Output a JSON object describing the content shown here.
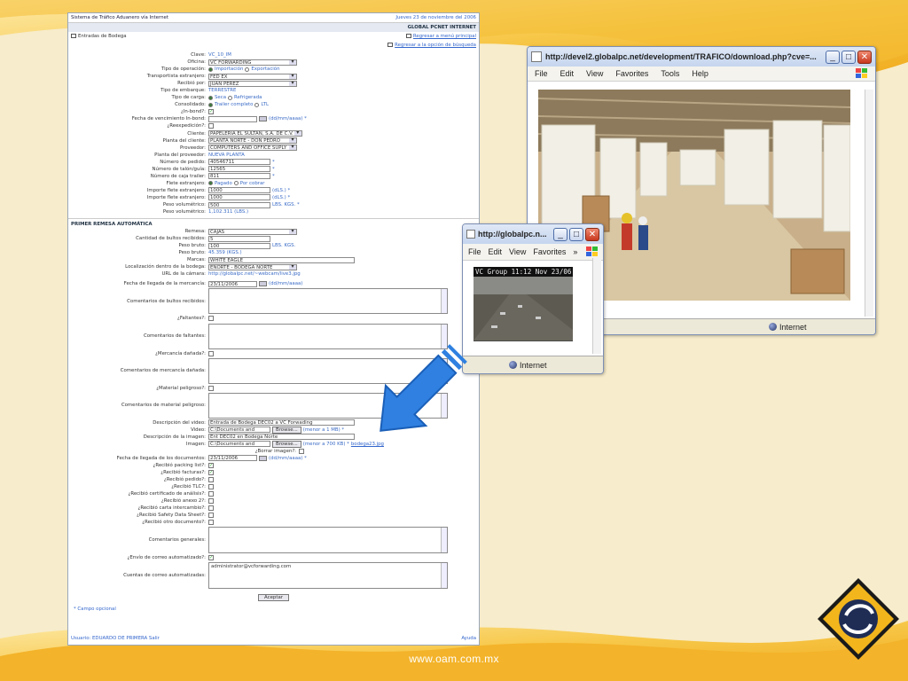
{
  "colors": {
    "accent_blue": "#2f80e0",
    "brand_yellow": "#f2b51c",
    "diamond_outline": "#1a1a1a"
  },
  "form": {
    "system_title": "Sistema de Tráfico Aduanero vía Internet",
    "date": "Jueves 23 de noviembre del 2006",
    "company": "GLOBAL PCNET INTERNET",
    "section_title": "Entradas de Bodega",
    "link_main_menu": "Regresar a menú principal",
    "link_search": "Regresar a la opción de búsqueda",
    "fields": [
      {
        "label": "Clave:",
        "type": "text",
        "value": "VC_10_IM",
        "blue": true
      },
      {
        "label": "Oficina:",
        "type": "select",
        "value": "VC FORWARDING"
      },
      {
        "label": "Tipo de operación:",
        "type": "radio",
        "options": [
          "Importación",
          "Exportación"
        ],
        "selected": 0
      },
      {
        "label": "Transportista extranjero:",
        "type": "select",
        "value": "FED EX"
      },
      {
        "label": "Recibió por:",
        "type": "select",
        "value": "JUAN PEREZ"
      },
      {
        "label": "Tipo de embarque:",
        "type": "text",
        "value": "TERRESTRE",
        "blue": true
      },
      {
        "label": "Tipo de carga:",
        "type": "radio",
        "options": [
          "Seca",
          "Refrigerada"
        ],
        "selected": 0
      },
      {
        "label": "Consolidado:",
        "type": "radio",
        "options": [
          "Trailer completo",
          "LTL"
        ],
        "selected": 0
      },
      {
        "label": "¿In-bond?:",
        "type": "check",
        "checked": true
      },
      {
        "label": "Fecha de vencimiento In-bond:",
        "type": "date",
        "value": "",
        "note": "(dd/mm/aaaa) *"
      },
      {
        "label": "¿Reexpedición?:",
        "type": "check",
        "checked": false
      },
      {
        "label": "Cliente:",
        "type": "select",
        "value": "PAPELERIA EL SULTAN, S.A. DE C.V."
      },
      {
        "label": "Planta del cliente:",
        "type": "select",
        "value": "PLANTA NORTE - DON PEDRO"
      },
      {
        "label": "Proveedor:",
        "type": "select",
        "value": "COMPUTERS AND OFFICE SUPLY"
      },
      {
        "label": "Planta del proveedor:",
        "type": "text",
        "value": "NUEVA PLANTA",
        "blue": true
      },
      {
        "label": "Número de pedido:",
        "type": "input",
        "value": "40546711",
        "note": "*"
      },
      {
        "label": "Número de talón/guía:",
        "type": "input",
        "value": "12565",
        "note": "*"
      },
      {
        "label": "Número de caja trailer:",
        "type": "input",
        "value": "811",
        "note": "*"
      },
      {
        "label": "Flete extranjero:",
        "type": "radio",
        "options": [
          "Pagado",
          "Por cobrar"
        ],
        "selected": 0
      },
      {
        "label": "Importe flete extranjero:",
        "type": "input",
        "value": "1000",
        "note": "(dLS.) *"
      },
      {
        "label": "Importe flete extranjero:",
        "type": "input",
        "value": "1000",
        "note": "(dLS.) *"
      },
      {
        "label": "Peso volumétrico:",
        "type": "input",
        "value": "500",
        "note": "LBS.  KGS. *"
      },
      {
        "label": "Peso volumétrico:",
        "type": "text",
        "value": "1,102.311 (LBS.)",
        "blue": true
      }
    ],
    "first_pass_title": "PRIMER REMESA AUTOMÁTICA",
    "fields2": [
      {
        "label": "Remesa:",
        "type": "select",
        "value": "CAJAS"
      },
      {
        "label": "Cantidad de bultos recibidos:",
        "type": "input",
        "value": "5"
      },
      {
        "label": "Peso bruto:",
        "type": "input",
        "value": "100",
        "note": "LBS.  KGS."
      },
      {
        "label": "Peso bruto:",
        "type": "text",
        "value": "45.359 (KGS.)",
        "blue": true
      },
      {
        "label": "Marcas:",
        "type": "input",
        "value": "WHITE EAGLE"
      },
      {
        "label": "Localización dentro de la bodega:",
        "type": "select",
        "value": "ENORTE - BODEGA NORTE"
      },
      {
        "label": "URL de la cámara:",
        "type": "text",
        "value": "http://globalpc.net/~webcam/live3.jpg",
        "blue": true
      }
    ],
    "arrival_label": "Fecha de llegada de la mercancía:",
    "arrival_value": "23/11/2006",
    "arrival_note": "(dd/mm/aaaa)",
    "textareas": [
      {
        "label": "Comentarios de bultos recibidos:"
      },
      {
        "label": "¿Faltantes?:",
        "check": true
      },
      {
        "label": "Comentarios de faltantes:"
      },
      {
        "label": "¿Mercancía dañada?:",
        "check": true
      },
      {
        "label": "Comentarios de mercancía dañada:"
      },
      {
        "label": "¿Material peligroso?:",
        "check": true
      },
      {
        "label": "Comentarios de material peligroso:"
      }
    ],
    "video_desc_label": "Descripción del video:",
    "video_desc_value": "Entrada de Bodega DEC02 a VC Forwading",
    "video_label": "Video:",
    "video_path": "C:\\Documents and",
    "browse": "Browse...",
    "video_note": "(menor a 1 MB) *",
    "image_desc_label": "Descripción de la imagen:",
    "image_desc_value": "Ent DEC02 en Bodega Norte",
    "image_label": "Imagen:",
    "image_path": "C:\\Documents and",
    "image_note": "(menor a 700 KB) *",
    "image_link": "bodega23.jpg",
    "delete_image": "¿Borrar imagen?:",
    "docs_label": "Fecha de llegada de los documentos:",
    "docs_value": "23/11/2006",
    "docs_note": "(dd/mm/aaaa) *",
    "checks": [
      {
        "label": "¿Recibió packing list?:",
        "checked": true
      },
      {
        "label": "¿Recibió facturas?:",
        "checked": true
      },
      {
        "label": "¿Recibió pedido?:",
        "checked": false
      },
      {
        "label": "¿Recibió TLC?:",
        "checked": false
      },
      {
        "label": "¿Recibió certificado de análisis?:",
        "checked": false
      },
      {
        "label": "¿Recibió anexo 2?:",
        "checked": false
      },
      {
        "label": "¿Recibió carta intercambio?:",
        "checked": false
      },
      {
        "label": "¿Recibió Safety Data Sheet?:",
        "checked": false
      },
      {
        "label": "¿Recibió otro documento?:",
        "checked": false
      }
    ],
    "general_comments": "Comentarios generales:",
    "auto_email_label": "¿Envío de correo automatizado?:",
    "auto_email_accounts_label": "Cuentas de correo automatizadas:",
    "auto_email_value": "administrator@vcforwarding.com",
    "accept": "Aceptar",
    "optional_note": "* Campo opcional",
    "footer_user": "Usuario: EDUARDO DE PRIMERA   Salir",
    "footer_right": "Ayuda"
  },
  "browser_main": {
    "title": "http://devel2.globalpc.net/development/TRAFICO/download.php?cve=...",
    "menu": [
      "File",
      "Edit",
      "View",
      "Favorites",
      "Tools",
      "Help"
    ],
    "status": "Internet"
  },
  "browser_small": {
    "title": "http://globalpc.n...",
    "menu": [
      "File",
      "Edit",
      "View",
      "Favorites"
    ],
    "overflow": "»",
    "status": "Internet",
    "cam_label": "VC Group 11:12 Nov 23/06"
  },
  "footer_url": "www.oam.com.mx"
}
